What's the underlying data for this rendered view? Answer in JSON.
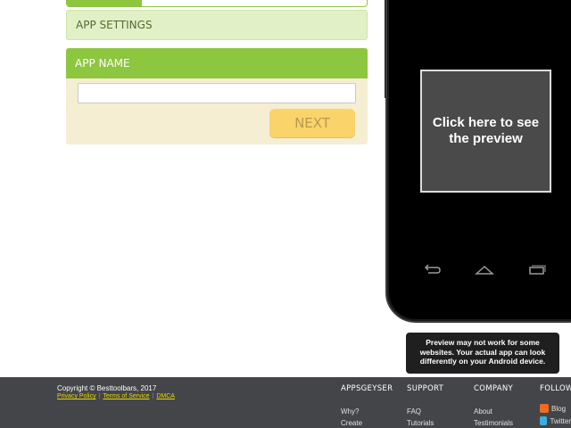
{
  "progress": {
    "fraction": 0.25
  },
  "settings": {
    "label": "APP SETTINGS"
  },
  "app_name": {
    "header": "APP NAME",
    "value": "",
    "placeholder": "",
    "next_label": "NEXT"
  },
  "preview": {
    "cta": "Click here to see the preview",
    "note": "Preview may not work for some websites. Your actual app can look differently on your Android device."
  },
  "phone_nav": [
    "back-icon",
    "home-icon",
    "recent-apps-icon"
  ],
  "footer": {
    "copyright": "Copyright © Besttoolbars, 2017",
    "legal": [
      "Privacy Policy",
      "Terms of Service",
      "DMCA"
    ],
    "columns": [
      {
        "title": "APPSGEYSER",
        "links": [
          "Why?",
          "Create"
        ]
      },
      {
        "title": "SUPPORT",
        "links": [
          "FAQ",
          "Tutorials"
        ]
      },
      {
        "title": "COMPANY",
        "links": [
          "About",
          "Testimonials"
        ]
      },
      {
        "title": "FOLLOW U",
        "links": [
          "Blog",
          "Twitter"
        ]
      }
    ]
  },
  "colors": {
    "green": "#8dc63f",
    "light_green": "#e2f0c7",
    "panel_bg": "#f5eed2",
    "button": "#fbd36b",
    "footer_bg": "#444548",
    "blog": "#f26b1d",
    "twitter": "#3aaee2"
  }
}
